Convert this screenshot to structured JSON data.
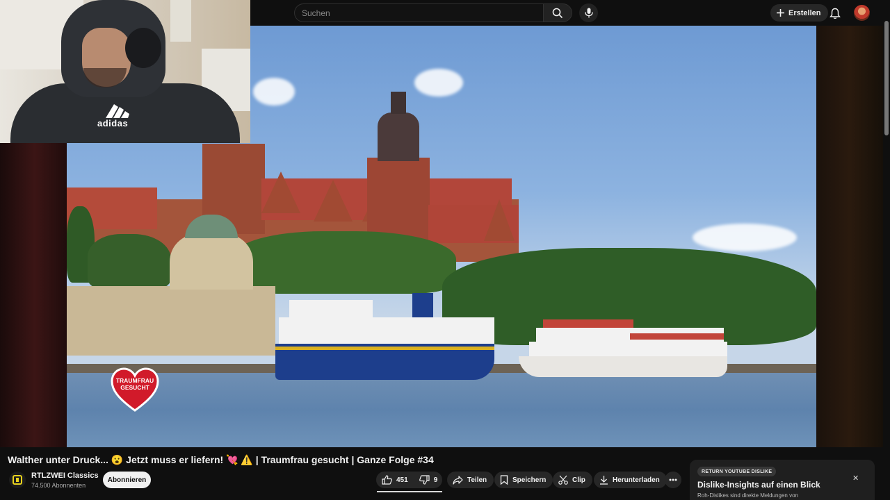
{
  "search": {
    "placeholder": "Suchen"
  },
  "header": {
    "create_label": "Erstellen"
  },
  "video": {
    "title": "Walther unter Druck... 😮 Jetzt muss er liefern! 💘 ⚠️ | Traumfrau gesucht | Ganze Folge #34",
    "show_logo_text": "TRAUMFRAU GESUCHT"
  },
  "channel": {
    "name": "RTLZWEI Classics",
    "subscribers": "74.500 Abonnenten",
    "subscribe_label": "Abonnieren"
  },
  "actions": {
    "likes": "451",
    "dislikes": "9",
    "share_label": "Teilen",
    "save_label": "Speichern",
    "clip_label": "Clip",
    "download_label": "Herunterladen"
  },
  "promo": {
    "tag": "RETURN YOUTUBE DISLIKE",
    "title": "Dislike-Insights auf einen Blick",
    "text": "Roh-Dislikes sind direkte Meldungen von"
  },
  "webcam": {
    "shirt_text": "adidas"
  },
  "icons": [
    "search-icon",
    "mic-icon",
    "plus-icon",
    "bell-icon",
    "thumbs-up-icon",
    "thumbs-down-icon",
    "share-icon",
    "bookmark-icon",
    "scissors-icon",
    "download-icon",
    "more-icon",
    "close-icon"
  ],
  "colors": {
    "background": "#0f0f0f",
    "pill": "#272727",
    "subscribe_bg": "#f1f1f1",
    "heart_red": "#d11a2a"
  }
}
